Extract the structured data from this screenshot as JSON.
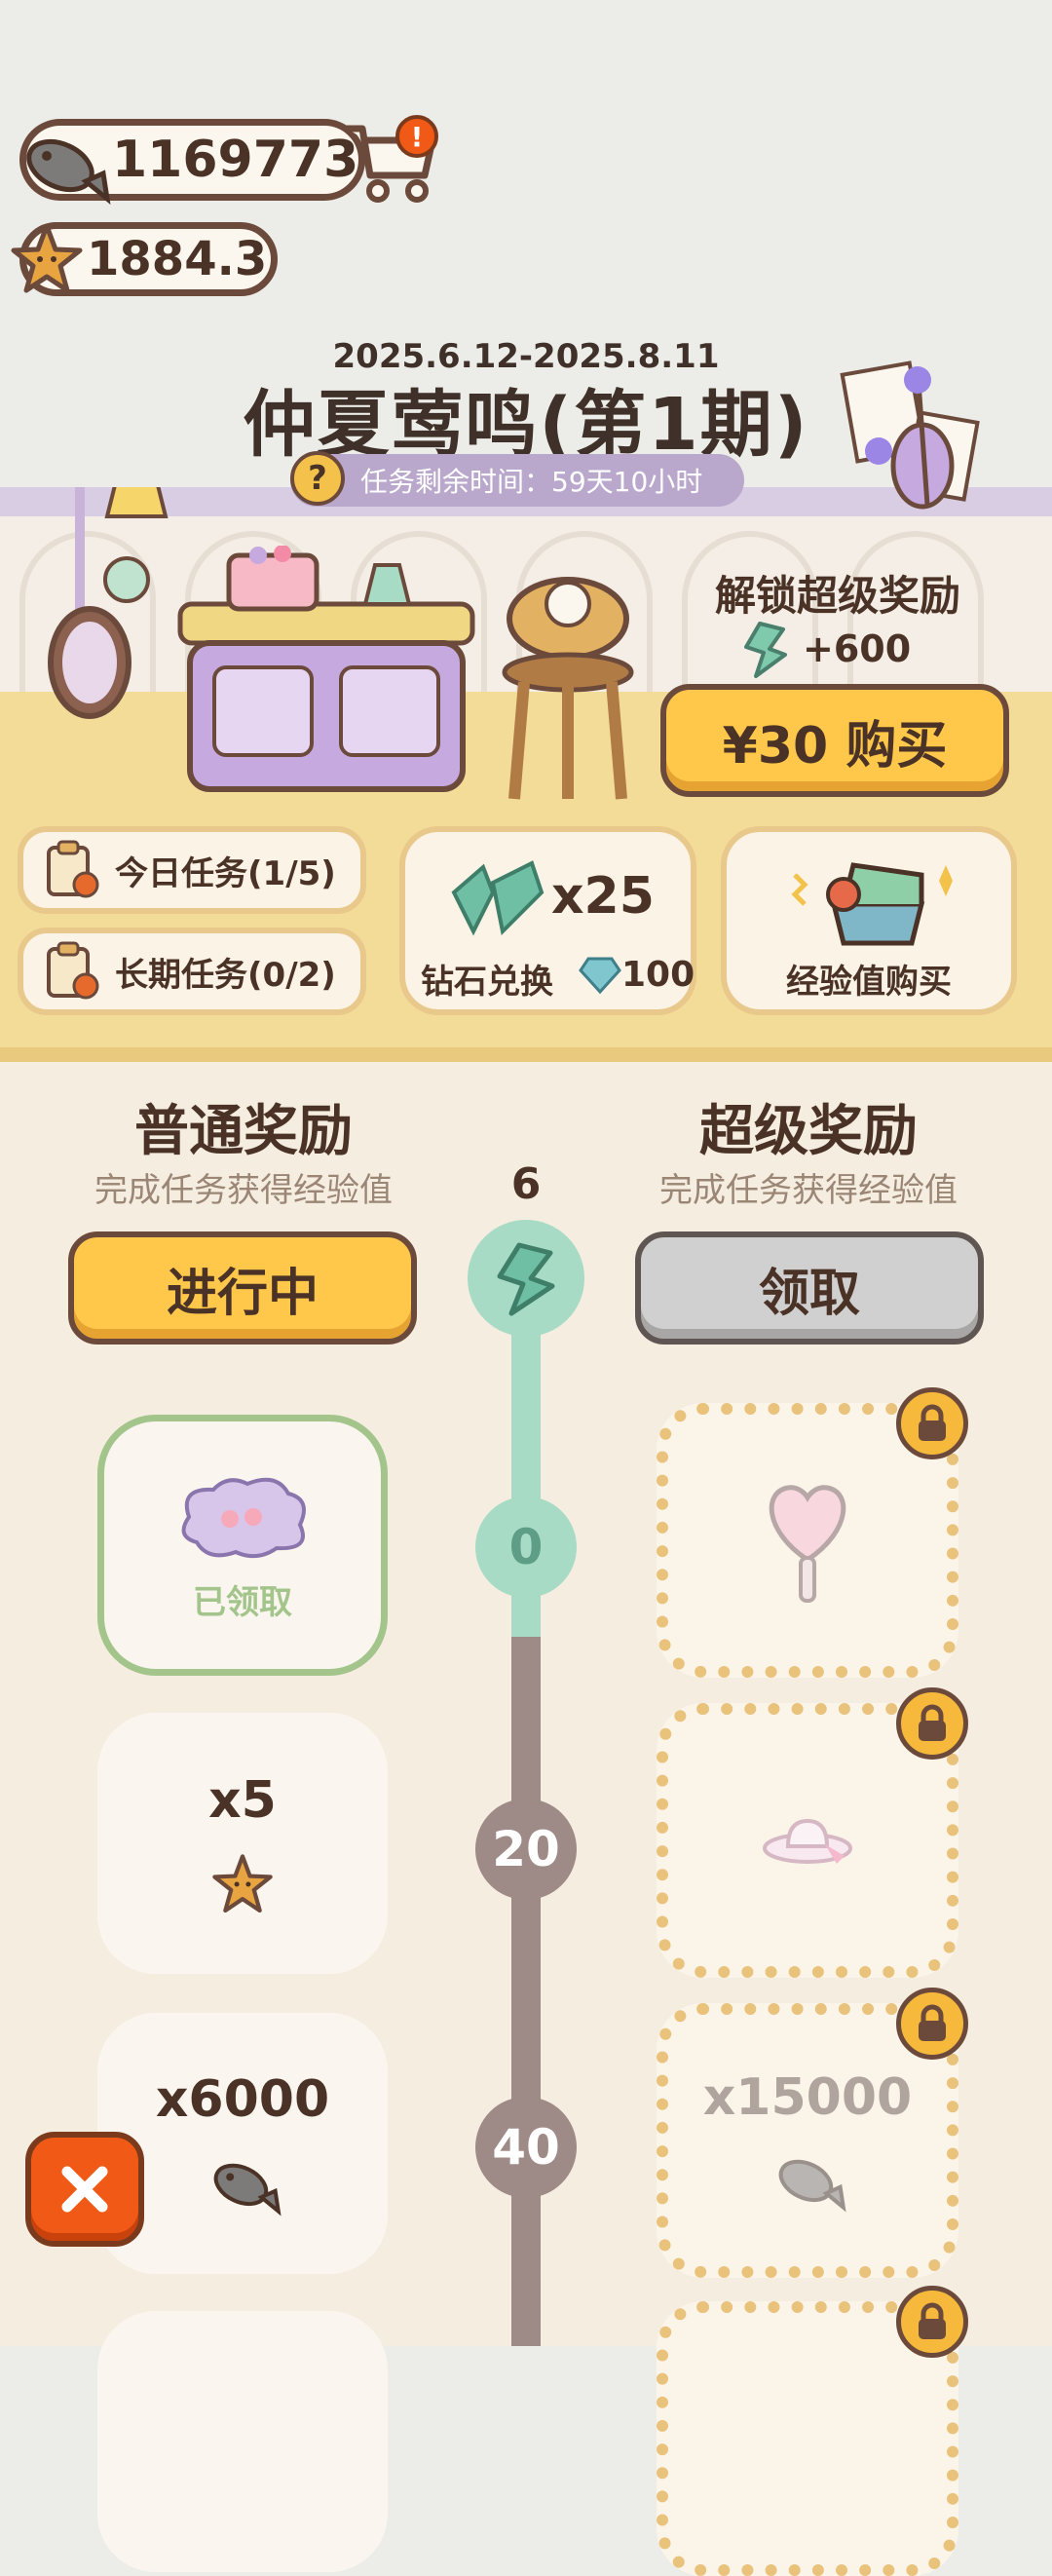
{
  "currency": {
    "fish_amount": "1169773",
    "star_amount": "1884.3",
    "shop_alert": "!"
  },
  "event": {
    "date_range": "2025.6.12-2025.8.11",
    "title": "仲夏莺鸣(第1期)",
    "timer_icon": "?",
    "timer_text": "任务剩余时间：59天10小时"
  },
  "buy": {
    "unlock_label": "解锁超级奖励",
    "exp_bonus": "+600",
    "buy_label": "¥30 购买"
  },
  "tasks": {
    "daily_label": "今日任务(1/5)",
    "long_label": "长期任务(0/2)"
  },
  "exchange": {
    "diamond_count": "x25",
    "diamond_label": "钻石兑换",
    "diamond_cost": "100",
    "exp_buy_label": "经验值购买"
  },
  "rewards": {
    "normal_title": "普通奖励",
    "normal_sub": "完成任务获得经验值",
    "super_title": "超级奖励",
    "super_sub": "完成任务获得经验值",
    "current_level": "6",
    "ongoing_label": "进行中",
    "claim_label": "领取",
    "claimed_label": "已领取",
    "nodes": [
      "0",
      "20",
      "40"
    ],
    "normal_items": [
      {
        "amount": "x5",
        "icon": "star-icon"
      },
      {
        "amount": "x6000",
        "icon": "fish-icon"
      }
    ],
    "super_fish_amount": "x15000"
  },
  "colors": {
    "accent_yellow": "#ffc84a",
    "track_green": "#a8dbc5",
    "track_grey": "#9e8a86",
    "close_orange": "#f15a16"
  }
}
